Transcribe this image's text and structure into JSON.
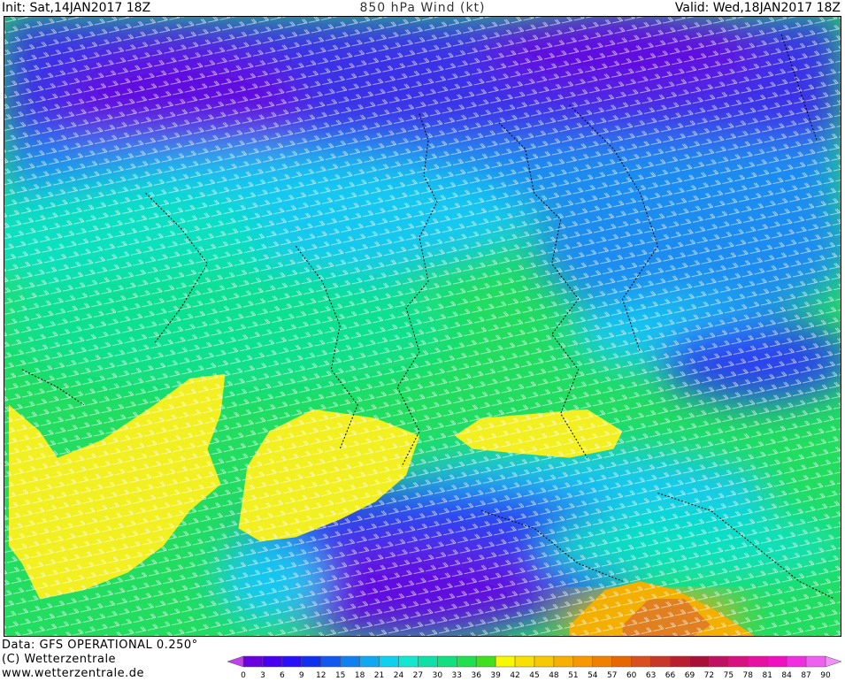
{
  "header": {
    "init": "Init: Sat,14JAN2017 18Z",
    "title": "850 hPa Wind (kt)",
    "valid": "Valid: Wed,18JAN2017 18Z"
  },
  "footer": {
    "source": "Data: GFS OPERATIONAL 0.250°",
    "copyright": "(C) Wetterzentrale",
    "url": "www.wetterzentrale.de"
  },
  "colorbar": {
    "ticks": [
      "0",
      "3",
      "6",
      "9",
      "12",
      "15",
      "18",
      "21",
      "24",
      "27",
      "30",
      "33",
      "36",
      "39",
      "42",
      "45",
      "48",
      "51",
      "54",
      "57",
      "60",
      "63",
      "66",
      "69",
      "72",
      "75",
      "78",
      "81",
      "84",
      "87",
      "90"
    ],
    "colors": [
      "#6a00e0",
      "#4a00f0",
      "#2a10f8",
      "#1030f0",
      "#1058f0",
      "#1080f0",
      "#10a8f0",
      "#10d0f0",
      "#10e8d0",
      "#10e0a8",
      "#10e080",
      "#20e050",
      "#40e020",
      "#f8f800",
      "#f8e000",
      "#f8c800",
      "#f8b000",
      "#f89800",
      "#f08000",
      "#e86800",
      "#d85020",
      "#c83828",
      "#b82030",
      "#a81038",
      "#c01060",
      "#d81080",
      "#e810a0",
      "#f010c0",
      "#f030e0",
      "#f060f0"
    ],
    "under_color": "#c040f0",
    "over_color": "#f090f8"
  },
  "map": {
    "wind_barbs": "white",
    "borders": "black"
  }
}
